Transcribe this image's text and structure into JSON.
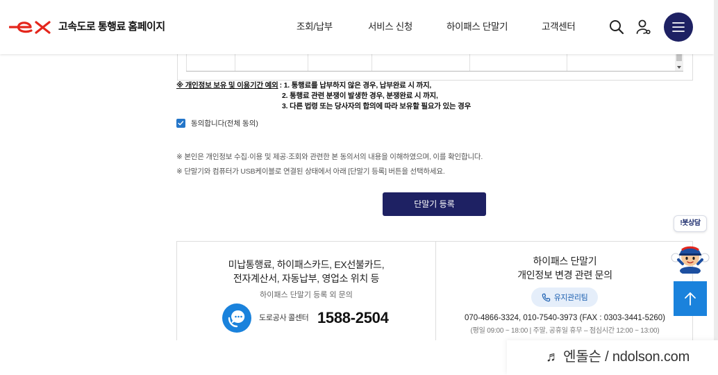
{
  "colors": {
    "brand_red": "#e4261c",
    "navy": "#1e2163",
    "accent_blue": "#1a82dc",
    "check_blue": "#2476c9"
  },
  "header": {
    "logo_text": "ex",
    "site_title": "고속도로 통행료 홈페이지",
    "nav": [
      {
        "label": "조회/납부"
      },
      {
        "label": "서비스 신청"
      },
      {
        "label": "하이패스 단말기"
      },
      {
        "label": "고객센터"
      }
    ],
    "icons": {
      "search": "search-icon",
      "user": "user-login-icon",
      "menu": "menu-icon"
    }
  },
  "consent": {
    "retention_label": "※ 개인정보 보유 및 이용기간 예외",
    "retention_lines": [
      ": 1. 통행료를 납부하지 않은 경우, 납부완료 시 까지,",
      "2. 통행료 관련 분쟁이 발생한 경우, 분쟁완료 시 까지,",
      "3. 다른 법령 또는 당사자의 합의에 따라 보유할 필요가 있는 경우"
    ],
    "agree_label": "동의합니다(전체 동의)",
    "agree_checked": true,
    "notes": [
      "※ 본인은 개인정보 수집·이용 및 제공·조회와 관련한 본 동의서의 내용을 이해하였으며, 이를 확인합니다.",
      "※ 단말기와 컴퓨터가 USB케이블로 연결된 상태에서 아래 [단말기 등록] 버튼을 선택하세요."
    ],
    "register_button": "단말기 등록"
  },
  "side": {
    "chatbot_label": "!봇상담",
    "mascot_icon": "mascot-image",
    "top_button_icon": "arrow-up-icon"
  },
  "contact": {
    "general": {
      "title_lines": [
        "미납통행료, 하이패스카드, EX선불카드,",
        "전자계산서, 자동납부, 영업소 위치 등"
      ],
      "subtitle": "하이패스 단말기 등록 외 문의",
      "center_label": "도로공사 콜센터",
      "phone": "1588-2504",
      "icon": "chat-phone-icon"
    },
    "privacy": {
      "title_lines": [
        "하이패스 단말기",
        "개인정보 변경 관련 문의"
      ],
      "team_button": "유지관리팀",
      "team_icon": "phone-icon",
      "phones": "070-4866-3324, 010-7540-3973 (FAX : 0303-3441-5260)",
      "hours": "(평일 09:00 ~ 18:00 | 주말, 공휴일 휴무 – 점심시간 12:00 ~ 13:00)"
    }
  },
  "watermark": "♬ 엔돌슨 / ndolson.com"
}
